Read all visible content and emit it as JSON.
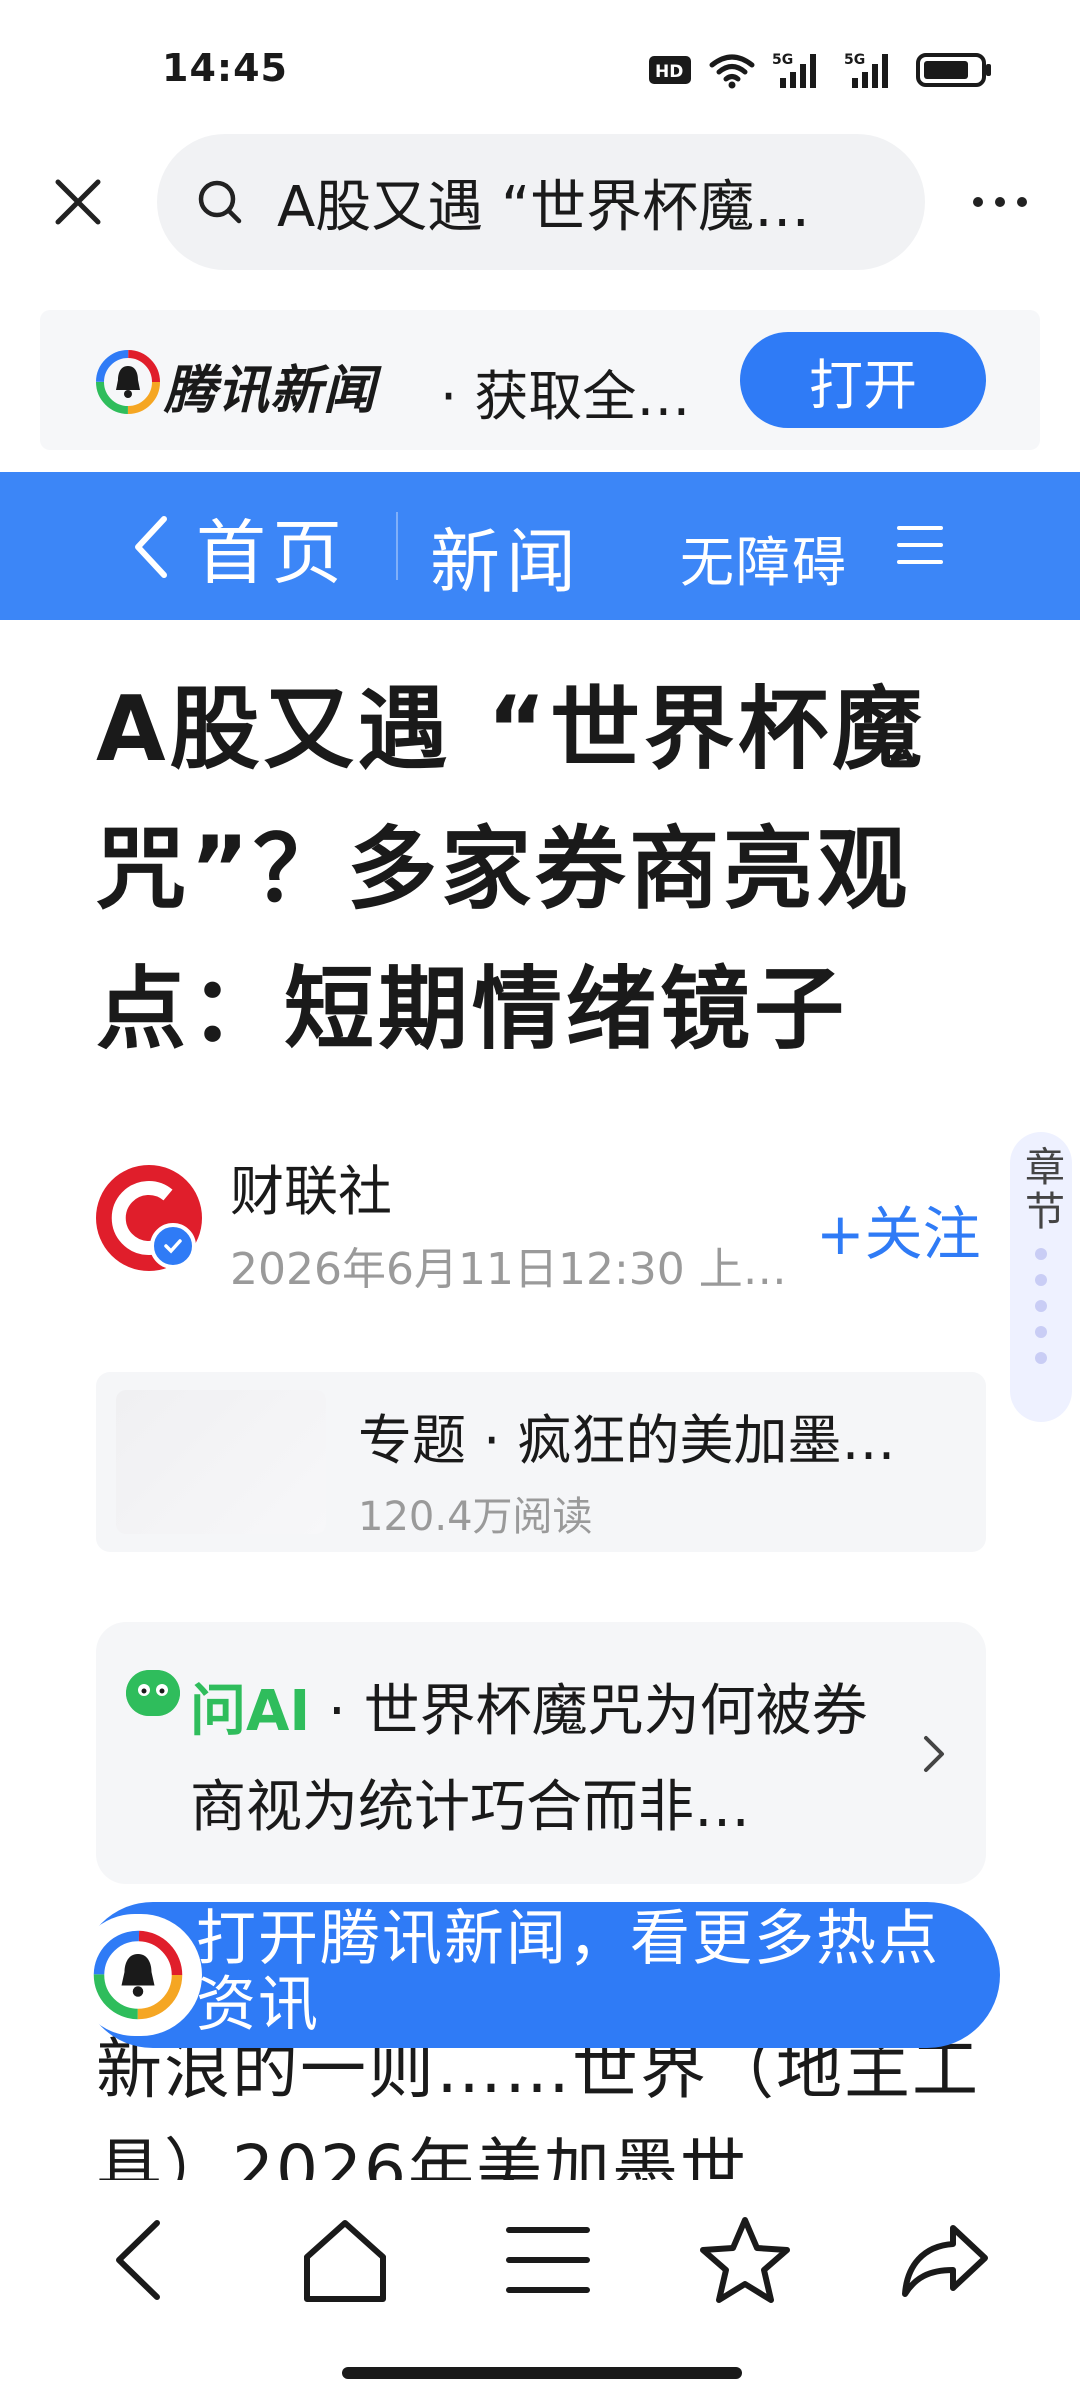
{
  "status_bar": {
    "time": "14:45",
    "icons": [
      "hd-icon",
      "wifi-icon",
      "signal-5g-icon",
      "signal-5g-icon",
      "battery-icon"
    ],
    "network_labels": [
      "5G",
      "5G"
    ]
  },
  "browser": {
    "search_query": "A股又遇 “世界杯魔…"
  },
  "app_banner": {
    "app_name": "腾讯新闻",
    "tagline": "· 获取全…",
    "open_label": "打开"
  },
  "nav": {
    "home_label": "首页",
    "news_label": "新闻",
    "accessibility_label": "无障碍"
  },
  "article": {
    "title": "A股又遇 “世界杯魔咒”？多家券商亮观点：短期情绪镜子",
    "author": "财联社",
    "meta": "2026年6月11日12:30 上…",
    "follow_label": "+关注",
    "chapter_label": "章节",
    "topic": {
      "title": "专题 · 疯狂的美加墨…",
      "reads": "120.4万阅读"
    },
    "ask_ai": {
      "label": "问AI",
      "text": " · 世界杯魔咒为何被券商视为统计巧合而非…"
    },
    "partial_body": "新浪的一则……世界（地主工具）2026年美加墨世"
  },
  "promo": {
    "text": "打开腾讯新闻，看更多热点资讯"
  },
  "colors": {
    "brand_blue": "#3c86f7",
    "button_blue": "#2f7bf6",
    "ai_green": "#2fbd5c",
    "avatar_red": "#e01e2b"
  }
}
